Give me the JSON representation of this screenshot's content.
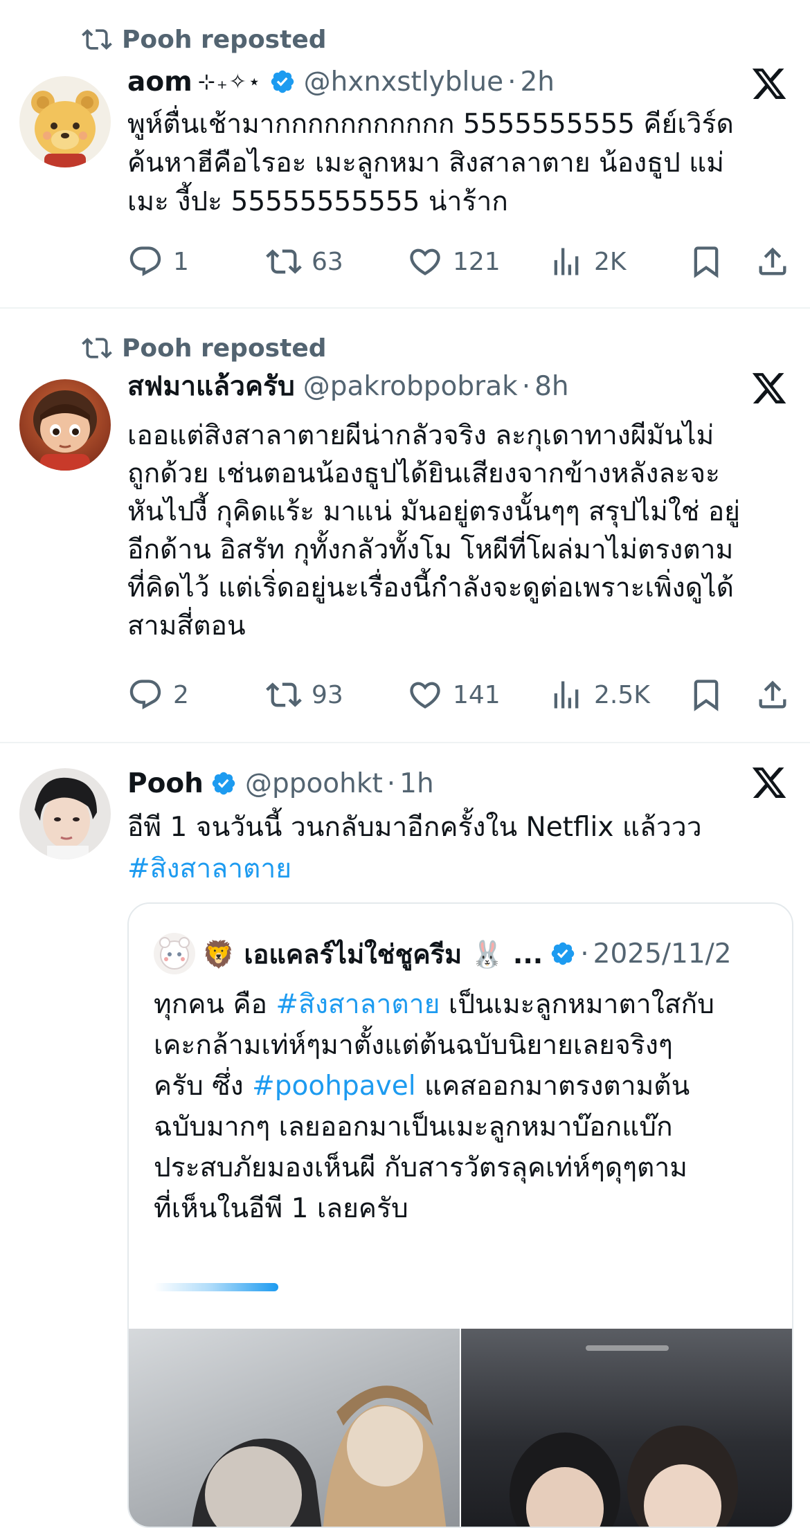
{
  "posts": [
    {
      "repost_label": "Pooh reposted",
      "display_name": "aom",
      "name_decoration": "⊹₊✧⋆",
      "verified": true,
      "handle": "@hxnxstlyblue",
      "separator": "·",
      "time": "2h",
      "text_lines": [
        "พูห์ตื่นเช้ามากกกกกกกกกกก 5555555555 คีย์เวิร์ด",
        "ค้นหาฮีคือไรอะ เมะลูกหมา สิงสาลาตาย น้องธูป แม่",
        "เมะ งี้ปะ 55555555555 น่าร้าก"
      ],
      "stats": {
        "replies": "1",
        "reposts": "63",
        "likes": "121",
        "views": "2K"
      }
    },
    {
      "repost_label": "Pooh reposted",
      "display_name": "สฟมาแล้วครับ",
      "verified": false,
      "handle": "@pakrobpobrak",
      "separator": "·",
      "time": "8h",
      "text_lines": [
        "เออแต่สิงสาลาตายผีน่ากลัวจริง ละกุเดาทางผีมันไม่",
        "ถูกด้วย เช่นตอนน้องธูปได้ยินเสียงจากข้างหลังละจะ",
        "หันไปงี้ กุคิดแร้ะ มาแน่ มันอยู่ตรงนั้นๆๆ สรุปไม่ใช่ อยู่",
        "อีกด้าน อิสรัท กุทั้งกลัวทั้งโม โหผีที่โผล่มาไม่ตรงตาม",
        "ที่คิดไว้ แต่เริ่ดอยู่นะเรื่องนี้กำลังจะดูต่อเพราะเพิ่งดูได้",
        "สามสี่ตอน"
      ],
      "stats": {
        "replies": "2",
        "reposts": "93",
        "likes": "141",
        "views": "2.5K"
      }
    },
    {
      "display_name": "Pooh",
      "verified": true,
      "handle": "@ppoohkt",
      "separator": "·",
      "time": "1h",
      "text_line_1": "อีพี 1 จนวันนี้ วนกลับมาอีกครั้งใน Netflix แล้ววว",
      "hashtag": "#สิงสาลาตาย",
      "quote": {
        "display_name": "🦁 เอแคลร์ไม่ใช่ชูครีม 🐰 ...",
        "verified": true,
        "separator": "·",
        "date": "2025/11/2",
        "segments": [
          {
            "t": "ทุกคน คือ ",
            "tag": false
          },
          {
            "t": "#สิงสาลาตาย",
            "tag": true
          },
          {
            "t": " เป็นเมะลูกหมาตาใสกับ",
            "tag": false
          },
          {
            "br": true
          },
          {
            "t": "เคะกล้ามเท่ห์ๆมาตั้งแต่ต้นฉบับนิยายเลยจริงๆ",
            "tag": false
          },
          {
            "br": true
          },
          {
            "t": "ครับ ซึ่ง ",
            "tag": false
          },
          {
            "t": "#poohpavel",
            "tag": true
          },
          {
            "t": " แคสออกมาตรงตามต้น",
            "tag": false
          },
          {
            "br": true
          },
          {
            "t": "ฉบับมากๆ  เลยออกมาเป็นเมะลูกหมาบ๊อกแบ๊ก",
            "tag": false
          },
          {
            "br": true
          },
          {
            "t": "ประสบภัยมองเห็นผี กับสารวัตรลุคเท่ห์ๆดุๆตาม",
            "tag": false
          },
          {
            "br": true
          },
          {
            "t": "ที่เห็นในอีพี 1 เลยครับ",
            "tag": false
          }
        ],
        "media_progress": 0.45
      }
    }
  ],
  "icons": {
    "repost": "repost-icon",
    "verified": "verified-badge-icon",
    "x_logo": "x-logo-icon",
    "reply": "reply-icon",
    "like": "like-icon",
    "views": "views-icon",
    "bookmark": "bookmark-icon",
    "share": "share-icon"
  },
  "colors": {
    "accent": "#1d9bf0",
    "text": "#0f1419",
    "muted": "#536471",
    "divider": "#eff3f4"
  }
}
